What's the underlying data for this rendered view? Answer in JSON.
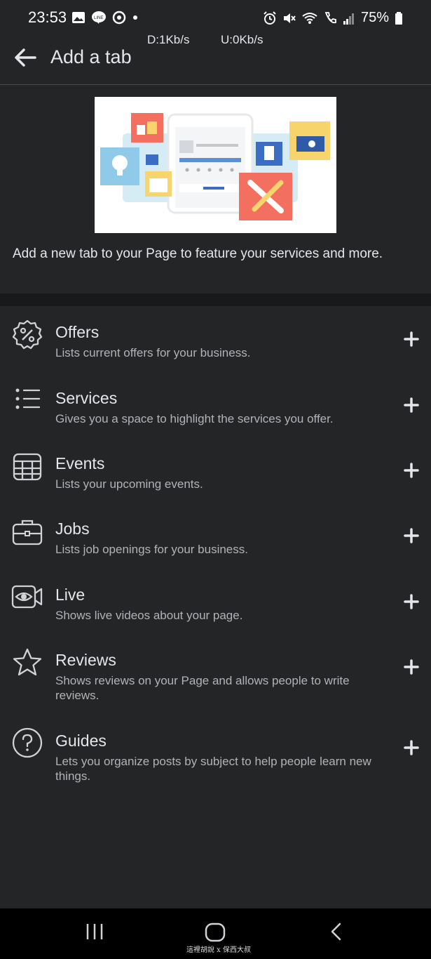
{
  "status_bar": {
    "time": "23:53",
    "battery": "75%",
    "left_icons": [
      "gallery-icon",
      "line-icon",
      "sync-icon",
      "dot-icon"
    ],
    "right_icons": [
      "alarm-icon",
      "mute-icon",
      "wifi-icon",
      "call-icon",
      "signal-icon",
      "battery-icon"
    ]
  },
  "network_speed": {
    "down": "D:1Kb/s",
    "up": "U:0Kb/s"
  },
  "header": {
    "title": "Add a tab"
  },
  "intro": {
    "text": "Add a new tab to your Page to feature your services and more."
  },
  "tabs": [
    {
      "title": "Offers",
      "description": "Lists current offers for your business.",
      "icon": "offers-icon"
    },
    {
      "title": "Services",
      "description": "Gives you a space to highlight the services you offer.",
      "icon": "services-icon"
    },
    {
      "title": "Events",
      "description": "Lists your upcoming events.",
      "icon": "events-icon"
    },
    {
      "title": "Jobs",
      "description": "Lists job openings for your business.",
      "icon": "jobs-icon"
    },
    {
      "title": "Live",
      "description": "Shows live videos about your page.",
      "icon": "live-icon"
    },
    {
      "title": "Reviews",
      "description": "Shows reviews on your Page and allows people to write reviews.",
      "icon": "reviews-icon"
    },
    {
      "title": "Guides",
      "description": "Lets you organize posts by subject to help people learn new things.",
      "icon": "guides-icon"
    }
  ],
  "watermark": "這裡胡說 x 保西大叔",
  "colors": {
    "background": "#242526",
    "text": "#e4e6eb",
    "secondary_text": "#b0b3b8",
    "nav_bar": "#000000"
  }
}
